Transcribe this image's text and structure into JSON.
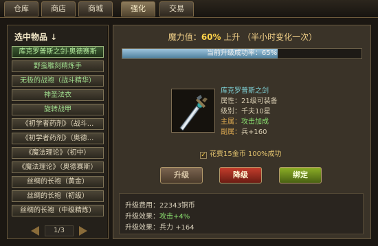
{
  "tabs": [
    {
      "label": "仓库"
    },
    {
      "label": "商店"
    },
    {
      "label": "商城"
    },
    {
      "label": "强化"
    },
    {
      "label": "交易"
    }
  ],
  "left_panel": {
    "title": "选中物品 ↓",
    "items": [
      "库克罗普斯之剑·奥德赛斯",
      "野蛮雕刻精炼手",
      "无极的战袍（战斗精华）",
      "神圣法衣",
      "旋转战甲",
      "《初学者药剂》（战斗...",
      "《初学者药剂》（奥德...",
      "《魔法理论》（初中）",
      "《魔法理论》（奥德赛斯）",
      "丝绸的长袍（黄金）",
      "丝绸的长袍（初级）",
      "丝绸的长袍（中级精炼）"
    ],
    "page": "1/3"
  },
  "main": {
    "magic_prefix": "魔力值：",
    "magic_value": "60%",
    "magic_suffix": " 上升 （半小时变化一次）",
    "progress_text": "当前升级成功率：65%",
    "progress_value": 0.65,
    "item_name": "库克罗普斯之剑",
    "stats": [
      {
        "label": "属性：",
        "value": "21级可装备"
      },
      {
        "label": "级别：",
        "value": "千夫10星"
      },
      {
        "label": "主属：",
        "value": "攻击加成"
      },
      {
        "label": "副属：",
        "value": "兵+160"
      }
    ],
    "checkbox_label": "花费15金币 100%成功",
    "buttons": {
      "upgrade": "升级",
      "downgrade": "降级",
      "bind": "绑定"
    },
    "info": [
      {
        "label": "升级费用：",
        "value": "22343铜币"
      },
      {
        "label": "升级效果：",
        "value": "攻击+4%"
      },
      {
        "label": "升级效果：",
        "value": "兵力 +164"
      }
    ]
  },
  "colors": {
    "accent_gold": "#ffd34a",
    "progress_fill": "#4e7f9c",
    "downgrade": "#c43d2c",
    "bind": "#8cae26"
  }
}
